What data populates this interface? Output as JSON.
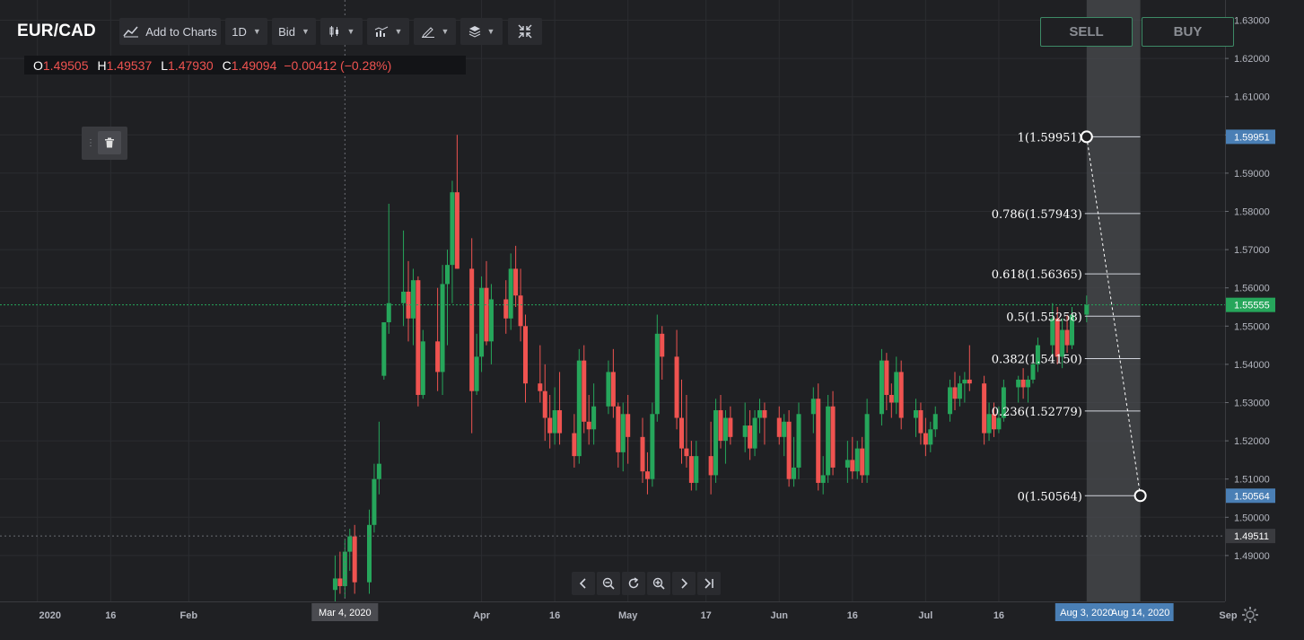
{
  "header": {
    "symbol": "EUR/CAD",
    "add_to_charts": "Add to Charts",
    "interval": "1D",
    "price_type": "Bid"
  },
  "ohlc": {
    "o_label": "O",
    "o": "1.49505",
    "h_label": "H",
    "h": "1.49537",
    "l_label": "L",
    "l": "1.47930",
    "c_label": "C",
    "c": "1.49094",
    "change": "−0.00412 (−0.28%)"
  },
  "trade": {
    "sell": "SELL",
    "buy": "BUY"
  },
  "colors": {
    "background": "#1f2023",
    "up": "#26a65b",
    "down": "#ef5350",
    "grid": "#2b2c30",
    "fib_line": "#d1d4dc",
    "current_price": "#26a65b",
    "marker_blue": "#4a7fb5"
  },
  "icons": [
    "chart-line-icon",
    "candlestick-icon",
    "indicators-icon",
    "draw-icon",
    "layers-icon",
    "collapse-icon",
    "trash-icon",
    "chevron-left-icon",
    "zoom-out-icon",
    "reset-icon",
    "zoom-in-icon",
    "chevron-right-icon",
    "jump-end-icon",
    "gear-icon"
  ],
  "chart_data": {
    "type": "candlestick",
    "y_range": [
      1.478,
      1.632
    ],
    "y_ticks": [
      "1.63000",
      "1.62000",
      "1.61000",
      "1.60000",
      "1.59000",
      "1.58000",
      "1.57000",
      "1.56000",
      "1.55000",
      "1.54000",
      "1.53000",
      "1.52000",
      "1.51000",
      "1.50000",
      "1.49000"
    ],
    "x_ticks": [
      "2020",
      "16",
      "Feb",
      "Apr",
      "16",
      "May",
      "17",
      "Jun",
      "16",
      "Jul",
      "16",
      "Sep"
    ],
    "x_tick_dates": [
      "2020-01-01",
      "2020-01-16",
      "2020-02-01",
      "2020-04-01",
      "2020-04-16",
      "2020-05-01",
      "2020-05-17",
      "2020-06-01",
      "2020-06-16",
      "2020-07-01",
      "2020-07-16",
      "2020-09-01"
    ],
    "x_range": [
      "2019-12-28",
      "2020-09-09"
    ],
    "crosshair_date": "2020-03-04",
    "crosshair_label": "Mar 4, 2020",
    "selected_range_labels": [
      "Aug 3, 2020",
      "Aug 14, 2020"
    ],
    "selected_range_dates": [
      "2020-08-03",
      "2020-08-14"
    ],
    "price_labels": [
      {
        "value": 1.59951,
        "text": "1.59951",
        "style": "blue"
      },
      {
        "value": 1.55555,
        "text": "1.55555",
        "style": "green"
      },
      {
        "value": 1.50564,
        "text": "1.50564",
        "style": "blue"
      },
      {
        "value": 1.49511,
        "text": "1.49511",
        "style": "gray"
      }
    ],
    "current_price": 1.55555,
    "dotted_price": 1.49511,
    "fib_retracement": {
      "start": {
        "date": "2020-08-03",
        "price": 1.59951
      },
      "end": {
        "date": "2020-08-14",
        "price": 1.50564
      },
      "levels": [
        {
          "ratio": "1",
          "price": 1.59951,
          "text": "1(1.59951)"
        },
        {
          "ratio": "0.786",
          "price": 1.57943,
          "text": "0.786(1.57943)"
        },
        {
          "ratio": "0.618",
          "price": 1.56365,
          "text": "0.618(1.56365)"
        },
        {
          "ratio": "0.5",
          "price": 1.55258,
          "text": "0.5(1.55258)"
        },
        {
          "ratio": "0.382",
          "price": 1.5415,
          "text": "0.382(1.54150)"
        },
        {
          "ratio": "0.236",
          "price": 1.52779,
          "text": "0.236(1.52779)"
        },
        {
          "ratio": "0",
          "price": 1.50564,
          "text": "0(1.50564)"
        }
      ]
    },
    "candles": [
      {
        "d": "2020-03-02",
        "o": 1.481,
        "h": 1.49,
        "l": 1.478,
        "c": 1.484
      },
      {
        "d": "2020-03-03",
        "o": 1.484,
        "h": 1.491,
        "l": 1.48,
        "c": 1.482
      },
      {
        "d": "2020-03-04",
        "o": 1.482,
        "h": 1.494,
        "l": 1.479,
        "c": 1.491
      },
      {
        "d": "2020-03-05",
        "o": 1.491,
        "h": 1.497,
        "l": 1.486,
        "c": 1.495
      },
      {
        "d": "2020-03-06",
        "o": 1.495,
        "h": 1.498,
        "l": 1.48,
        "c": 1.483
      },
      {
        "d": "2020-03-09",
        "o": 1.483,
        "h": 1.502,
        "l": 1.48,
        "c": 1.498
      },
      {
        "d": "2020-03-10",
        "o": 1.498,
        "h": 1.514,
        "l": 1.496,
        "c": 1.51
      },
      {
        "d": "2020-03-11",
        "o": 1.51,
        "h": 1.525,
        "l": 1.506,
        "c": 1.514
      },
      {
        "d": "2020-03-12",
        "o": 1.537,
        "h": 1.546,
        "l": 1.536,
        "c": 1.551
      },
      {
        "d": "2020-03-13",
        "o": 1.551,
        "h": 1.582,
        "l": 1.548,
        "c": 1.556
      },
      {
        "d": "2020-03-16",
        "o": 1.556,
        "h": 1.575,
        "l": 1.55,
        "c": 1.559
      },
      {
        "d": "2020-03-17",
        "o": 1.559,
        "h": 1.567,
        "l": 1.546,
        "c": 1.552
      },
      {
        "d": "2020-03-18",
        "o": 1.552,
        "h": 1.565,
        "l": 1.545,
        "c": 1.562
      },
      {
        "d": "2020-03-19",
        "o": 1.562,
        "h": 1.563,
        "l": 1.529,
        "c": 1.532
      },
      {
        "d": "2020-03-20",
        "o": 1.532,
        "h": 1.549,
        "l": 1.531,
        "c": 1.546
      },
      {
        "d": "2020-03-23",
        "o": 1.546,
        "h": 1.56,
        "l": 1.533,
        "c": 1.538
      },
      {
        "d": "2020-03-24",
        "o": 1.538,
        "h": 1.566,
        "l": 1.532,
        "c": 1.561
      },
      {
        "d": "2020-03-25",
        "o": 1.561,
        "h": 1.57,
        "l": 1.545,
        "c": 1.566
      },
      {
        "d": "2020-03-26",
        "o": 1.566,
        "h": 1.588,
        "l": 1.556,
        "c": 1.585
      },
      {
        "d": "2020-03-27",
        "o": 1.585,
        "h": 1.6,
        "l": 1.565,
        "c": 1.565
      },
      {
        "d": "2020-03-30",
        "o": 1.565,
        "h": 1.573,
        "l": 1.522,
        "c": 1.533
      },
      {
        "d": "2020-03-31",
        "o": 1.533,
        "h": 1.548,
        "l": 1.532,
        "c": 1.542
      },
      {
        "d": "2020-04-01",
        "o": 1.542,
        "h": 1.563,
        "l": 1.538,
        "c": 1.56
      },
      {
        "d": "2020-04-02",
        "o": 1.56,
        "h": 1.567,
        "l": 1.545,
        "c": 1.546
      },
      {
        "d": "2020-04-03",
        "o": 1.546,
        "h": 1.561,
        "l": 1.54,
        "c": 1.557
      },
      {
        "d": "2020-04-06",
        "o": 1.557,
        "h": 1.562,
        "l": 1.548,
        "c": 1.552
      },
      {
        "d": "2020-04-07",
        "o": 1.552,
        "h": 1.569,
        "l": 1.549,
        "c": 1.565
      },
      {
        "d": "2020-04-08",
        "o": 1.565,
        "h": 1.571,
        "l": 1.555,
        "c": 1.558
      },
      {
        "d": "2020-04-09",
        "o": 1.558,
        "h": 1.565,
        "l": 1.546,
        "c": 1.55
      },
      {
        "d": "2020-04-10",
        "o": 1.55,
        "h": 1.553,
        "l": 1.53,
        "c": 1.535
      },
      {
        "d": "2020-04-13",
        "o": 1.535,
        "h": 1.545,
        "l": 1.53,
        "c": 1.533
      },
      {
        "d": "2020-04-14",
        "o": 1.533,
        "h": 1.54,
        "l": 1.52,
        "c": 1.526
      },
      {
        "d": "2020-04-15",
        "o": 1.526,
        "h": 1.532,
        "l": 1.518,
        "c": 1.522
      },
      {
        "d": "2020-04-16",
        "o": 1.522,
        "h": 1.534,
        "l": 1.519,
        "c": 1.528
      },
      {
        "d": "2020-04-17",
        "o": 1.528,
        "h": 1.538,
        "l": 1.519,
        "c": 1.522
      },
      {
        "d": "2020-04-20",
        "o": 1.522,
        "h": 1.527,
        "l": 1.513,
        "c": 1.516
      },
      {
        "d": "2020-04-21",
        "o": 1.516,
        "h": 1.544,
        "l": 1.514,
        "c": 1.541
      },
      {
        "d": "2020-04-22",
        "o": 1.541,
        "h": 1.545,
        "l": 1.522,
        "c": 1.525
      },
      {
        "d": "2020-04-23",
        "o": 1.525,
        "h": 1.532,
        "l": 1.519,
        "c": 1.523
      },
      {
        "d": "2020-04-24",
        "o": 1.523,
        "h": 1.535,
        "l": 1.519,
        "c": 1.529
      },
      {
        "d": "2020-04-27",
        "o": 1.529,
        "h": 1.541,
        "l": 1.527,
        "c": 1.538
      },
      {
        "d": "2020-04-28",
        "o": 1.538,
        "h": 1.544,
        "l": 1.526,
        "c": 1.529
      },
      {
        "d": "2020-04-29",
        "o": 1.529,
        "h": 1.53,
        "l": 1.513,
        "c": 1.517
      },
      {
        "d": "2020-04-30",
        "o": 1.517,
        "h": 1.53,
        "l": 1.512,
        "c": 1.527
      },
      {
        "d": "2020-05-01",
        "o": 1.527,
        "h": 1.532,
        "l": 1.514,
        "c": 1.521
      },
      {
        "d": "2020-05-04",
        "o": 1.521,
        "h": 1.526,
        "l": 1.509,
        "c": 1.512
      },
      {
        "d": "2020-05-05",
        "o": 1.512,
        "h": 1.517,
        "l": 1.506,
        "c": 1.51
      },
      {
        "d": "2020-05-06",
        "o": 1.51,
        "h": 1.53,
        "l": 1.508,
        "c": 1.527
      },
      {
        "d": "2020-05-07",
        "o": 1.527,
        "h": 1.553,
        "l": 1.525,
        "c": 1.548
      },
      {
        "d": "2020-05-08",
        "o": 1.548,
        "h": 1.55,
        "l": 1.536,
        "c": 1.542
      },
      {
        "d": "2020-05-11",
        "o": 1.542,
        "h": 1.549,
        "l": 1.523,
        "c": 1.526
      },
      {
        "d": "2020-05-12",
        "o": 1.526,
        "h": 1.536,
        "l": 1.514,
        "c": 1.518
      },
      {
        "d": "2020-05-13",
        "o": 1.518,
        "h": 1.532,
        "l": 1.513,
        "c": 1.516
      },
      {
        "d": "2020-05-14",
        "o": 1.516,
        "h": 1.52,
        "l": 1.507,
        "c": 1.509
      },
      {
        "d": "2020-05-15",
        "o": 1.509,
        "h": 1.52,
        "l": 1.507,
        "c": 1.516
      },
      {
        "d": "2020-05-18",
        "o": 1.516,
        "h": 1.525,
        "l": 1.506,
        "c": 1.511
      },
      {
        "d": "2020-05-19",
        "o": 1.511,
        "h": 1.531,
        "l": 1.509,
        "c": 1.528
      },
      {
        "d": "2020-05-20",
        "o": 1.528,
        "h": 1.532,
        "l": 1.518,
        "c": 1.52
      },
      {
        "d": "2020-05-21",
        "o": 1.52,
        "h": 1.528,
        "l": 1.514,
        "c": 1.526
      },
      {
        "d": "2020-05-22",
        "o": 1.526,
        "h": 1.529,
        "l": 1.519,
        "c": 1.521
      },
      {
        "d": "2020-05-25",
        "o": 1.521,
        "h": 1.53,
        "l": 1.517,
        "c": 1.524
      },
      {
        "d": "2020-05-26",
        "o": 1.524,
        "h": 1.528,
        "l": 1.515,
        "c": 1.518
      },
      {
        "d": "2020-05-27",
        "o": 1.518,
        "h": 1.528,
        "l": 1.516,
        "c": 1.526
      },
      {
        "d": "2020-05-28",
        "o": 1.526,
        "h": 1.531,
        "l": 1.522,
        "c": 1.528
      },
      {
        "d": "2020-05-29",
        "o": 1.528,
        "h": 1.53,
        "l": 1.519,
        "c": 1.526
      },
      {
        "d": "2020-06-01",
        "o": 1.526,
        "h": 1.529,
        "l": 1.519,
        "c": 1.521
      },
      {
        "d": "2020-06-02",
        "o": 1.521,
        "h": 1.527,
        "l": 1.516,
        "c": 1.525
      },
      {
        "d": "2020-06-03",
        "o": 1.525,
        "h": 1.528,
        "l": 1.508,
        "c": 1.51
      },
      {
        "d": "2020-06-04",
        "o": 1.51,
        "h": 1.521,
        "l": 1.508,
        "c": 1.513
      },
      {
        "d": "2020-06-05",
        "o": 1.513,
        "h": 1.53,
        "l": 1.51,
        "c": 1.527
      },
      {
        "d": "2020-06-08",
        "o": 1.527,
        "h": 1.534,
        "l": 1.522,
        "c": 1.531
      },
      {
        "d": "2020-06-09",
        "o": 1.531,
        "h": 1.535,
        "l": 1.507,
        "c": 1.509
      },
      {
        "d": "2020-06-10",
        "o": 1.509,
        "h": 1.516,
        "l": 1.506,
        "c": 1.511
      },
      {
        "d": "2020-06-11",
        "o": 1.511,
        "h": 1.532,
        "l": 1.509,
        "c": 1.529
      },
      {
        "d": "2020-06-12",
        "o": 1.529,
        "h": 1.533,
        "l": 1.511,
        "c": 1.513
      },
      {
        "d": "2020-06-15",
        "o": 1.513,
        "h": 1.52,
        "l": 1.509,
        "c": 1.515
      },
      {
        "d": "2020-06-16",
        "o": 1.515,
        "h": 1.521,
        "l": 1.51,
        "c": 1.512
      },
      {
        "d": "2020-06-17",
        "o": 1.512,
        "h": 1.52,
        "l": 1.51,
        "c": 1.518
      },
      {
        "d": "2020-06-18",
        "o": 1.518,
        "h": 1.521,
        "l": 1.509,
        "c": 1.511
      },
      {
        "d": "2020-06-19",
        "o": 1.511,
        "h": 1.531,
        "l": 1.509,
        "c": 1.527
      },
      {
        "d": "2020-06-22",
        "o": 1.527,
        "h": 1.544,
        "l": 1.524,
        "c": 1.541
      },
      {
        "d": "2020-06-23",
        "o": 1.541,
        "h": 1.543,
        "l": 1.528,
        "c": 1.532
      },
      {
        "d": "2020-06-24",
        "o": 1.532,
        "h": 1.535,
        "l": 1.526,
        "c": 1.53
      },
      {
        "d": "2020-06-25",
        "o": 1.53,
        "h": 1.542,
        "l": 1.527,
        "c": 1.538
      },
      {
        "d": "2020-06-26",
        "o": 1.538,
        "h": 1.541,
        "l": 1.523,
        "c": 1.526
      },
      {
        "d": "2020-06-29",
        "o": 1.526,
        "h": 1.531,
        "l": 1.521,
        "c": 1.528
      },
      {
        "d": "2020-06-30",
        "o": 1.528,
        "h": 1.53,
        "l": 1.519,
        "c": 1.522
      },
      {
        "d": "2020-07-01",
        "o": 1.522,
        "h": 1.526,
        "l": 1.516,
        "c": 1.519
      },
      {
        "d": "2020-07-02",
        "o": 1.519,
        "h": 1.525,
        "l": 1.517,
        "c": 1.523
      },
      {
        "d": "2020-07-03",
        "o": 1.523,
        "h": 1.529,
        "l": 1.521,
        "c": 1.527
      },
      {
        "d": "2020-07-06",
        "o": 1.527,
        "h": 1.536,
        "l": 1.525,
        "c": 1.534
      },
      {
        "d": "2020-07-07",
        "o": 1.534,
        "h": 1.538,
        "l": 1.528,
        "c": 1.531
      },
      {
        "d": "2020-07-08",
        "o": 1.531,
        "h": 1.537,
        "l": 1.529,
        "c": 1.535
      },
      {
        "d": "2020-07-09",
        "o": 1.535,
        "h": 1.538,
        "l": 1.53,
        "c": 1.536
      },
      {
        "d": "2020-07-10",
        "o": 1.536,
        "h": 1.545,
        "l": 1.533,
        "c": 1.535
      },
      {
        "d": "2020-07-13",
        "o": 1.535,
        "h": 1.537,
        "l": 1.519,
        "c": 1.522
      },
      {
        "d": "2020-07-14",
        "o": 1.522,
        "h": 1.53,
        "l": 1.52,
        "c": 1.527
      },
      {
        "d": "2020-07-15",
        "o": 1.527,
        "h": 1.53,
        "l": 1.521,
        "c": 1.523
      },
      {
        "d": "2020-07-16",
        "o": 1.523,
        "h": 1.529,
        "l": 1.522,
        "c": 1.526
      },
      {
        "d": "2020-07-17",
        "o": 1.526,
        "h": 1.536,
        "l": 1.525,
        "c": 1.534
      },
      {
        "d": "2020-07-20",
        "o": 1.534,
        "h": 1.537,
        "l": 1.53,
        "c": 1.536
      },
      {
        "d": "2020-07-21",
        "o": 1.536,
        "h": 1.539,
        "l": 1.531,
        "c": 1.534
      },
      {
        "d": "2020-07-22",
        "o": 1.534,
        "h": 1.537,
        "l": 1.53,
        "c": 1.536
      },
      {
        "d": "2020-07-23",
        "o": 1.536,
        "h": 1.542,
        "l": 1.535,
        "c": 1.54
      },
      {
        "d": "2020-07-24",
        "o": 1.54,
        "h": 1.547,
        "l": 1.538,
        "c": 1.545
      },
      {
        "d": "2020-07-27",
        "o": 1.545,
        "h": 1.556,
        "l": 1.542,
        "c": 1.552
      },
      {
        "d": "2020-07-28",
        "o": 1.552,
        "h": 1.555,
        "l": 1.54,
        "c": 1.542
      },
      {
        "d": "2020-07-29",
        "o": 1.542,
        "h": 1.552,
        "l": 1.539,
        "c": 1.549
      },
      {
        "d": "2020-07-30",
        "o": 1.549,
        "h": 1.553,
        "l": 1.543,
        "c": 1.545
      },
      {
        "d": "2020-07-31",
        "o": 1.545,
        "h": 1.555,
        "l": 1.544,
        "c": 1.553
      },
      {
        "d": "2020-08-03",
        "o": 1.553,
        "h": 1.558,
        "l": 1.551,
        "c": 1.5555
      }
    ]
  }
}
